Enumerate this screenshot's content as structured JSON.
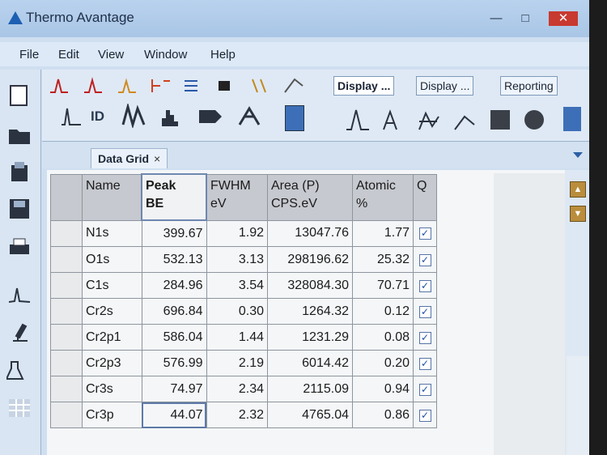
{
  "window": {
    "title": "Thermo Avantage"
  },
  "menu": [
    "File",
    "Edit",
    "View",
    "Window",
    "Help"
  ],
  "ribbon_tabs": [
    {
      "label": "Display ...",
      "active": true
    },
    {
      "label": "Display ...",
      "active": false
    },
    {
      "label": "Reporting",
      "active": false
    }
  ],
  "toolbar": {
    "id_label": "ID"
  },
  "doc_tab": {
    "label": "Data Grid",
    "close": "×"
  },
  "grid": {
    "headers": {
      "name": "Name",
      "be_1": "Peak",
      "be_2": "BE",
      "fwhm_1": "FWHM",
      "fwhm_2": "eV",
      "area_1": "Area (P)",
      "area_2": "CPS.eV",
      "atomic_1": "Atomic",
      "atomic_2": "%",
      "q": "Q"
    },
    "rows": [
      {
        "name": "N1s",
        "be": "399.67",
        "fwhm": "1.92",
        "area": "13047.76",
        "atomic": "1.77",
        "q": true
      },
      {
        "name": "O1s",
        "be": "532.13",
        "fwhm": "3.13",
        "area": "298196.62",
        "atomic": "25.32",
        "q": true
      },
      {
        "name": "C1s",
        "be": "284.96",
        "fwhm": "3.54",
        "area": "328084.30",
        "atomic": "70.71",
        "q": true
      },
      {
        "name": "Cr2s",
        "be": "696.84",
        "fwhm": "0.30",
        "area": "1264.32",
        "atomic": "0.12",
        "q": true
      },
      {
        "name": "Cr2p1",
        "be": "586.04",
        "fwhm": "1.44",
        "area": "1231.29",
        "atomic": "0.08",
        "q": true
      },
      {
        "name": "Cr2p3",
        "be": "576.99",
        "fwhm": "2.19",
        "area": "6014.42",
        "atomic": "0.20",
        "q": true
      },
      {
        "name": "Cr3s",
        "be": "74.97",
        "fwhm": "2.34",
        "area": "2115.09",
        "atomic": "0.94",
        "q": true
      },
      {
        "name": "Cr3p",
        "be": "44.07",
        "fwhm": "2.32",
        "area": "4765.04",
        "atomic": "0.86",
        "q": true
      }
    ]
  },
  "colors": {
    "titlebar": "#b9d2ee",
    "close": "#c8392f",
    "accent": "#1d5fb3"
  }
}
